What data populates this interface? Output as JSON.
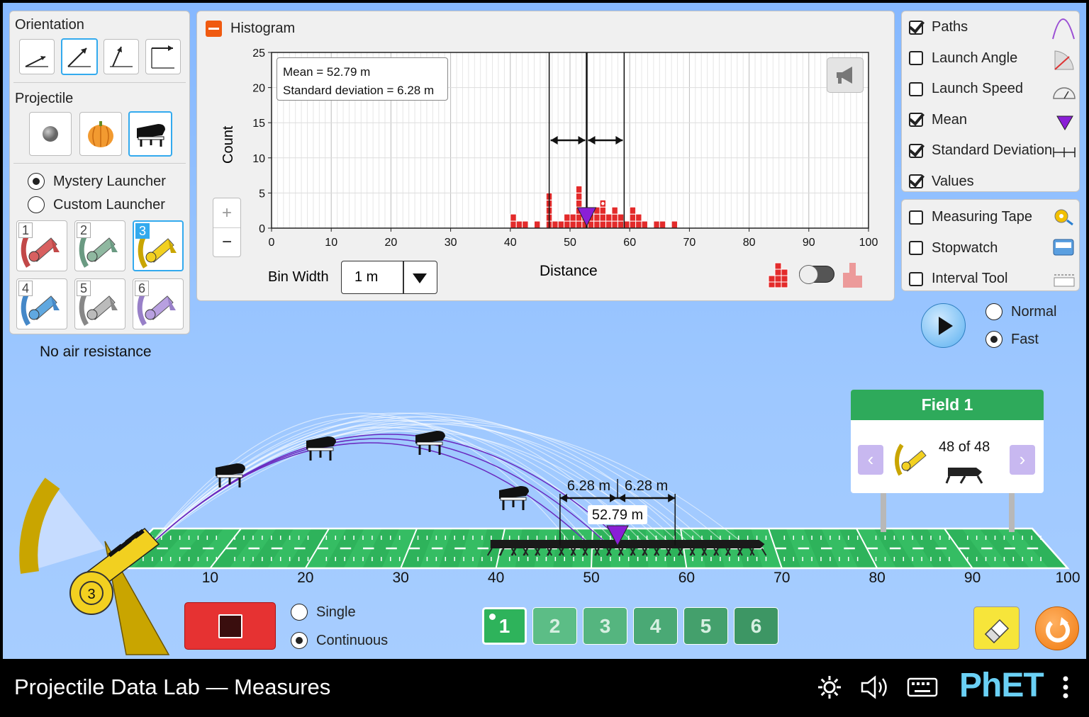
{
  "orientation": {
    "title": "Orientation"
  },
  "projectile": {
    "title": "Projectile"
  },
  "launcher": {
    "options": [
      "Mystery Launcher",
      "Custom Launcher"
    ],
    "selected": 0,
    "numbers": [
      "1",
      "2",
      "3",
      "4",
      "5",
      "6"
    ],
    "selected_launcher": 3,
    "note": "No air resistance"
  },
  "histogram": {
    "title": "Histogram",
    "ylabel": "Count",
    "xlabel": "Distance",
    "mean_text": "Mean = 52.79 m",
    "std_text": "Standard deviation = 6.28 m",
    "zoom_in": "+",
    "zoom_out": "−",
    "bin_width_label": "Bin Width",
    "bin_width_value": "1 m"
  },
  "chart_data": {
    "type": "bar",
    "x": [
      40,
      41,
      42,
      44,
      46,
      47,
      48,
      49,
      50,
      51,
      52,
      53,
      54,
      55,
      56,
      57,
      58,
      59,
      60,
      61,
      62,
      64,
      65,
      67
    ],
    "values": [
      2,
      1,
      1,
      1,
      5,
      1,
      1,
      2,
      2,
      6,
      2,
      2,
      3,
      4,
      2,
      3,
      2,
      1,
      3,
      2,
      1,
      1,
      1,
      1
    ],
    "xlabel": "Distance",
    "ylabel": "Count",
    "xlim": [
      0,
      100
    ],
    "ylim": [
      0,
      25
    ],
    "xticks": [
      0,
      10,
      20,
      30,
      40,
      50,
      60,
      70,
      80,
      90,
      100
    ],
    "yticks": [
      0,
      5,
      10,
      15,
      20,
      25
    ],
    "mean": 52.79,
    "std": 6.28,
    "grid": true
  },
  "checkboxes_top": [
    {
      "label": "Paths",
      "checked": true
    },
    {
      "label": "Launch Angle",
      "checked": false
    },
    {
      "label": "Launch Speed",
      "checked": false
    },
    {
      "label": "Mean",
      "checked": true
    },
    {
      "label": "Standard Deviation",
      "checked": true
    },
    {
      "label": "Values",
      "checked": true
    }
  ],
  "checkboxes_tools": [
    {
      "label": "Measuring Tape",
      "checked": false
    },
    {
      "label": "Stopwatch",
      "checked": false
    },
    {
      "label": "Interval Tool",
      "checked": false
    }
  ],
  "speed": {
    "options": [
      "Normal",
      "Fast"
    ],
    "selected": 1
  },
  "field_sign": {
    "title": "Field 1",
    "count": "48 of 48"
  },
  "field_labels": {
    "std_left": "6.28 m",
    "std_right": "6.28 m",
    "mean": "52.79 m",
    "ticks": [
      "10",
      "20",
      "30",
      "40",
      "50",
      "60",
      "70",
      "80",
      "90",
      "100"
    ]
  },
  "launch_mode": {
    "options": [
      "Single",
      "Continuous"
    ],
    "selected": 1
  },
  "fields": [
    "1",
    "2",
    "3",
    "4",
    "5",
    "6"
  ],
  "selected_field": 1,
  "launcher_cannon_number": "3",
  "colors": {
    "accent": "#33aaee",
    "bar": "#e32b2b",
    "mean": "#8a1fd6",
    "turf": "#2eb35b",
    "sign": "#2eaa5b"
  },
  "footer": {
    "title": "Projectile Data Lab — Measures",
    "brand": "PhET"
  }
}
